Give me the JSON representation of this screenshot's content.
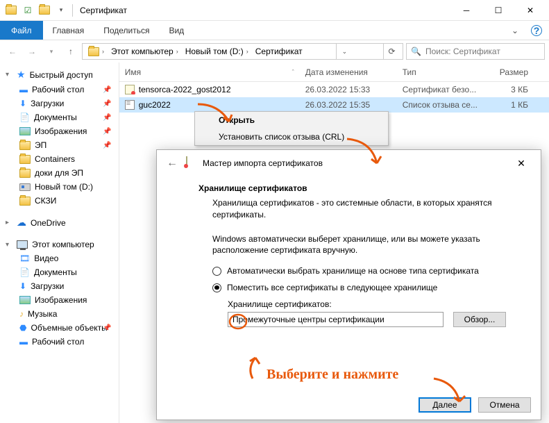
{
  "title": "Сертификат",
  "menu": {
    "file": "Файл",
    "home": "Главная",
    "share": "Поделиться",
    "view": "Вид"
  },
  "breadcrumb": [
    "Этот компьютер",
    "Новый том (D:)",
    "Сертификат"
  ],
  "search_placeholder": "Поиск: Сертификат",
  "columns": {
    "name": "Имя",
    "date": "Дата изменения",
    "type": "Тип",
    "size": "Размер"
  },
  "rows": [
    {
      "name": "tensorca-2022_gost2012",
      "date": "26.03.2022 15:33",
      "type": "Сертификат безо...",
      "size": "3 КБ"
    },
    {
      "name": "guc2022",
      "date": "26.03.2022 15:35",
      "type": "Список отзыва се...",
      "size": "1 КБ"
    }
  ],
  "ctx": {
    "open": "Открыть",
    "install": "Установить список отзыва (CRL)"
  },
  "nav": {
    "quick": "Быстрый доступ",
    "items1": [
      "Рабочий стол",
      "Загрузки",
      "Документы",
      "Изображения",
      "ЭП",
      "Containers",
      "доки для ЭП",
      "Новый том (D:)",
      "СКЗИ"
    ],
    "onedrive": "OneDrive",
    "thispc": "Этот компьютер",
    "items2": [
      "Видео",
      "Документы",
      "Загрузки",
      "Изображения",
      "Музыка",
      "Объемные объекты",
      "Рабочий стол"
    ]
  },
  "dialog": {
    "title": "Мастер импорта сертификатов",
    "h1": "Хранилище сертификатов",
    "p1": "Хранилища сертификатов - это системные области, в которых хранятся сертификаты.",
    "p2": "Windows автоматически выберет хранилище, или вы можете указать расположение сертификата вручную.",
    "r1": "Автоматически выбрать хранилище на основе типа сертификата",
    "r2": "Поместить все сертификаты в следующее хранилище",
    "store_label": "Хранилище сертификатов:",
    "store_value": "Промежуточные центры сертификации",
    "browse": "Обзор...",
    "next": "Далее",
    "cancel": "Отмена"
  },
  "annotation": "Выберите и нажмите"
}
